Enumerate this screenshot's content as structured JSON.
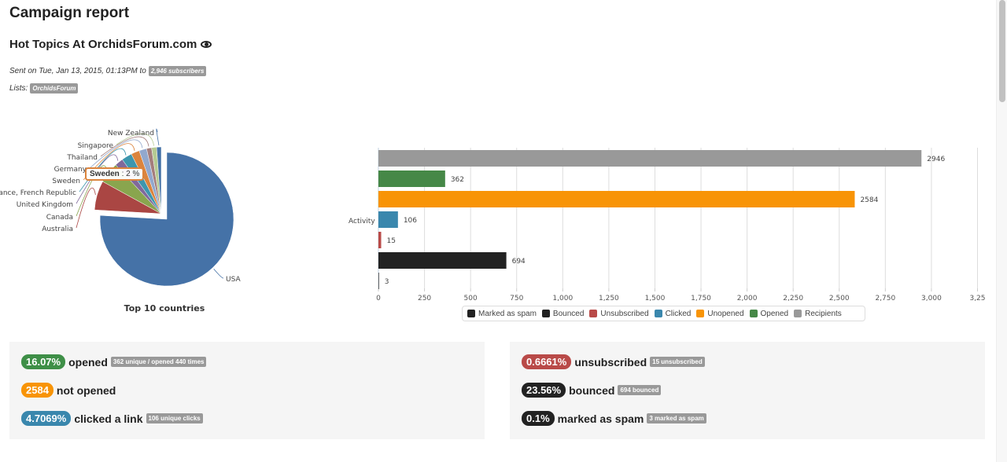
{
  "header": {
    "title": "Campaign report",
    "campaign_name": "Hot Topics At OrchidsForum.com",
    "sent_prefix": "Sent on Tue, Jan 13, 2015, 01:13PM to",
    "subscribers_tag": "2,946 subscribers",
    "lists_label": "Lists:",
    "list_tag": "OrchidsForum"
  },
  "tooltip": {
    "name": "Sweden",
    "value": " : 2 %"
  },
  "stats_left": [
    {
      "badge": "16.07%",
      "label": "opened",
      "note": "362 unique / opened 440 times",
      "color": "#3e8f47"
    },
    {
      "badge": "2584",
      "label": "not opened",
      "note": "",
      "color": "#f89406"
    },
    {
      "badge": "4.7069%",
      "label": "clicked a link",
      "note": "106 unique clicks",
      "color": "#3a87ad"
    }
  ],
  "stats_right": [
    {
      "badge": "0.6661%",
      "label": "unsubscribed",
      "note": "15 unsubscribed",
      "color": "#b94a48"
    },
    {
      "badge": "23.56%",
      "label": "bounced",
      "note": "694 bounced",
      "color": "#222222"
    },
    {
      "badge": "0.1%",
      "label": "marked as spam",
      "note": "3 marked as spam",
      "color": "#222222"
    }
  ],
  "chart_data": [
    {
      "type": "pie",
      "title": "Top 10 countries",
      "sliced_label": "Sweden",
      "slices": [
        {
          "name": "USA",
          "value": 75,
          "color": "#4572A7"
        },
        {
          "name": "Australia",
          "value": 7,
          "color": "#AA4643"
        },
        {
          "name": "Canada",
          "value": 5,
          "color": "#89A54E"
        },
        {
          "name": "United Kingdom",
          "value": 2,
          "color": "#80699B"
        },
        {
          "name": "France, French Republic",
          "value": 2.5,
          "color": "#3D96AE"
        },
        {
          "name": "Sweden",
          "value": 2,
          "color": "#DB843D"
        },
        {
          "name": "Germany",
          "value": 1.8,
          "color": "#92A8CD"
        },
        {
          "name": "Thailand",
          "value": 1.2,
          "color": "#A47D7C"
        },
        {
          "name": "Singapore",
          "value": 1.2,
          "color": "#B5CA92"
        },
        {
          "name": "New Zealand",
          "value": 1.1,
          "color": "#4572A7"
        }
      ]
    },
    {
      "type": "bar",
      "orientation": "horizontal",
      "category": "Activity",
      "xlim": [
        0,
        3250
      ],
      "ticks": [
        0,
        250,
        500,
        750,
        1000,
        1250,
        1500,
        1750,
        2000,
        2250,
        2500,
        2750,
        3000,
        3250
      ],
      "tick_labels": [
        "0",
        "250",
        "500",
        "750",
        "1,000",
        "1,250",
        "1,500",
        "1,750",
        "2,000",
        "2,250",
        "2,500",
        "2,750",
        "3,000",
        "3,25"
      ],
      "grid": true,
      "legend_position": "bottom",
      "series": [
        {
          "name": "Recipients",
          "value": 2946,
          "color": "#999999"
        },
        {
          "name": "Opened",
          "value": 362,
          "color": "#468847"
        },
        {
          "name": "Unopened",
          "value": 2584,
          "color": "#f89406"
        },
        {
          "name": "Clicked",
          "value": 106,
          "color": "#3a87ad"
        },
        {
          "name": "Unsubscribed",
          "value": 15,
          "color": "#b94a48"
        },
        {
          "name": "Bounced",
          "value": 694,
          "color": "#222222"
        },
        {
          "name": "Marked as spam",
          "value": 3,
          "color": "#222222"
        }
      ],
      "legend": [
        {
          "name": "Marked as spam",
          "color": "#222222"
        },
        {
          "name": "Bounced",
          "color": "#222222"
        },
        {
          "name": "Unsubscribed",
          "color": "#b94a48"
        },
        {
          "name": "Clicked",
          "color": "#3a87ad"
        },
        {
          "name": "Unopened",
          "color": "#f89406"
        },
        {
          "name": "Opened",
          "color": "#468847"
        },
        {
          "name": "Recipients",
          "color": "#999999"
        }
      ]
    }
  ]
}
